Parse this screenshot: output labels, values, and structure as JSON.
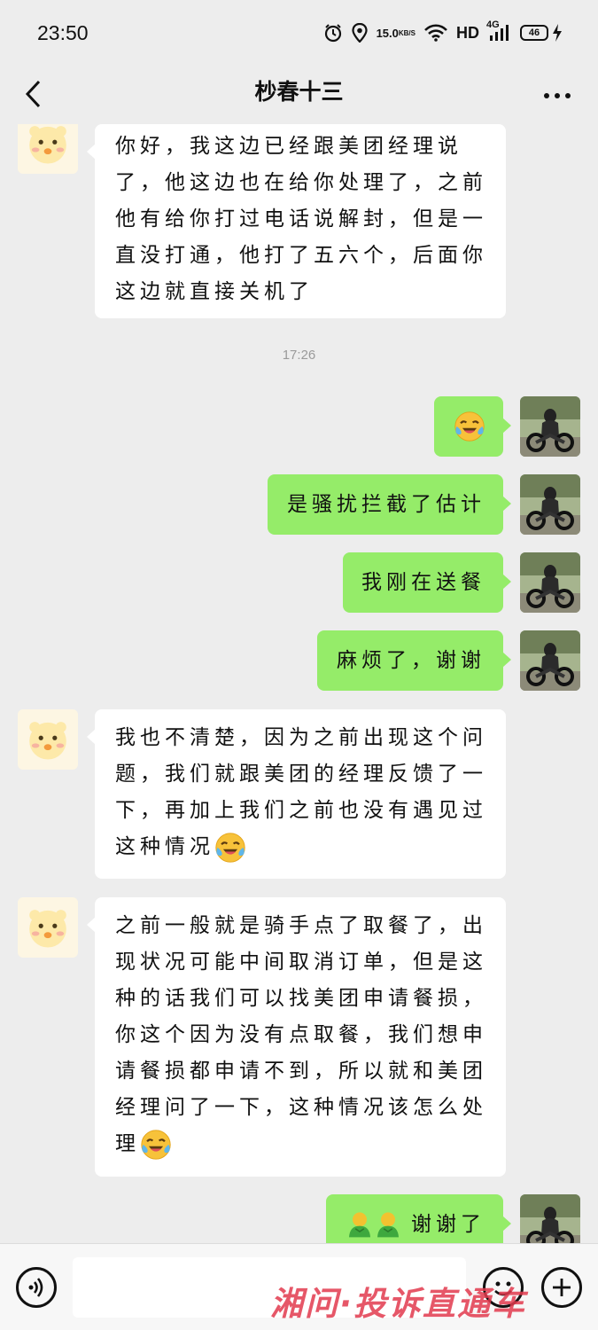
{
  "status_bar": {
    "time": "23:50",
    "net_speed_value": "15.0",
    "net_speed_unit": "KB/S",
    "hd_label": "HD",
    "network_type": "4G",
    "battery_level": "46",
    "icons": [
      "alarm-icon",
      "location-icon",
      "wifi-icon",
      "signal-icon",
      "battery-icon",
      "charging-icon"
    ]
  },
  "nav": {
    "title": "杪春十三",
    "back_icon": "chevron-left-icon",
    "more_icon": "more-dots-icon"
  },
  "chat": {
    "messages": [
      {
        "side": "left",
        "text": "你好，我这边已经跟美团经理说了，他这边也在给你处理了，之前他有给你打过电话说解封，但是一直没打通，他打了五六个，后面你这边就直接关机了"
      },
      {
        "type": "timestamp",
        "text": "17:26"
      },
      {
        "side": "right",
        "text": "",
        "emoji": "crying-laughing-emoji"
      },
      {
        "side": "right",
        "text": "是骚扰拦截了估计"
      },
      {
        "side": "right",
        "text": "我刚在送餐"
      },
      {
        "side": "right",
        "text": "麻烦了，谢谢"
      },
      {
        "side": "left",
        "text": "我也不清楚，因为之前出现这个问题，我们就跟美团的经理反馈了一下，再加上我们之前也没有遇见过这种情况",
        "emoji": "crying-laughing-emoji"
      },
      {
        "side": "left",
        "text": "之前一般就是骑手点了取餐了，出现状况可能中间取消订单，但是这种的话我们可以找美团申请餐损，你这个因为没有点取餐，我们想申请餐损都申请不到，所以就和美团经理问了一下，这种情况该怎么处理",
        "emoji": "crying-laughing-emoji"
      },
      {
        "side": "right",
        "text": "谢谢了",
        "emoji": "bowing-person-emoji-x2"
      }
    ]
  },
  "input_bar": {
    "voice_icon": "voice-icon",
    "emoji_icon": "smiley-icon",
    "plus_icon": "plus-icon",
    "input_value": ""
  },
  "watermark": {
    "text": "湘问·投诉直通车"
  },
  "colors": {
    "background": "#ededed",
    "right_bubble": "#95ec69",
    "left_bubble": "#ffffff",
    "watermark": "#e23a4e"
  }
}
